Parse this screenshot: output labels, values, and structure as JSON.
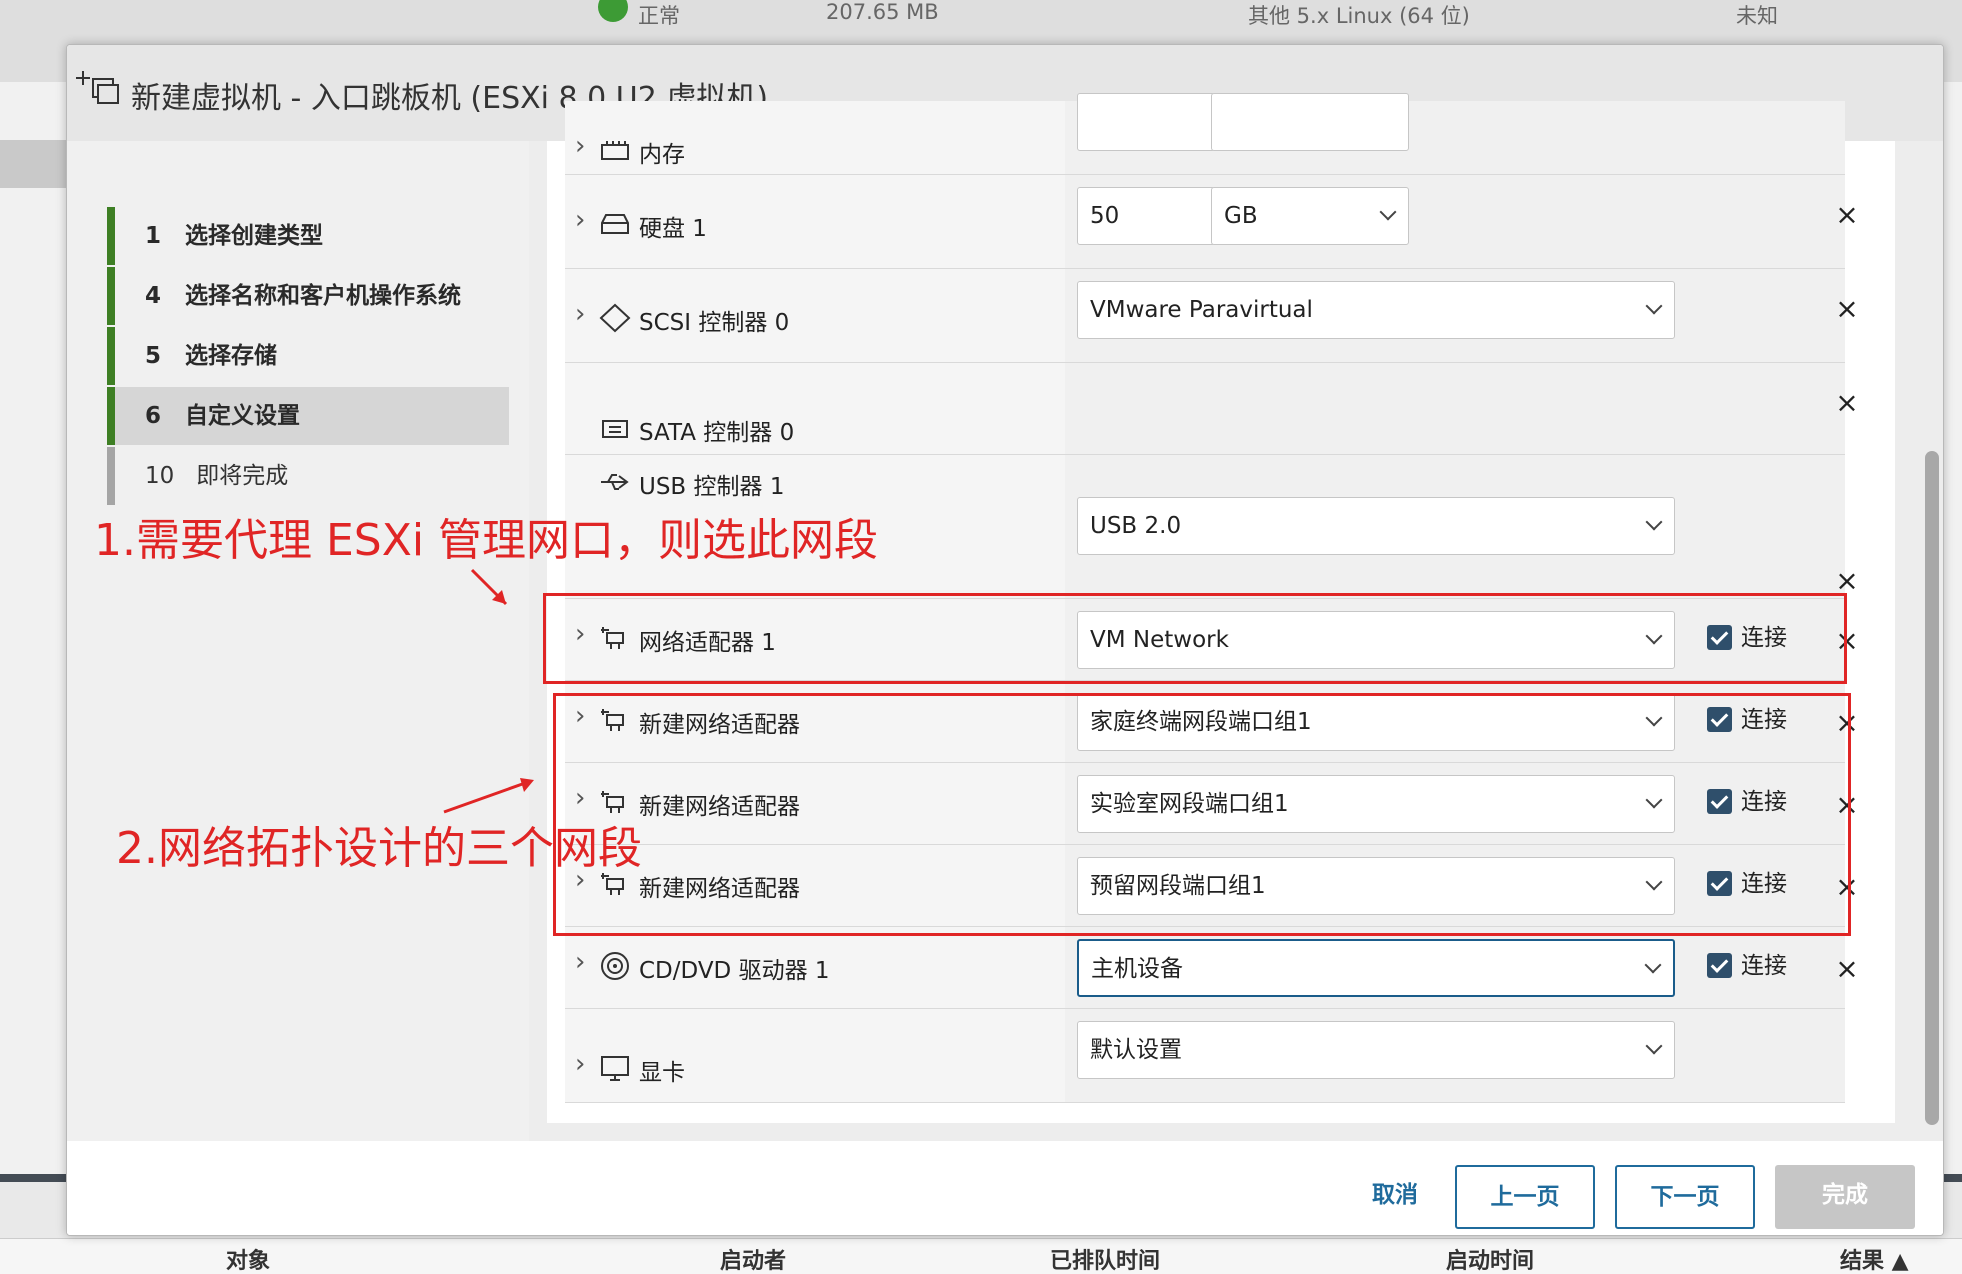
{
  "background": {
    "top_row": [
      "正常",
      "207.65 MB",
      "其他 5.x Linux (64 位)",
      "未知"
    ],
    "bottom_columns": [
      "对象",
      "启动者",
      "已排队时间",
      "启动时间",
      "结果 ▲"
    ]
  },
  "dialog": {
    "title": "新建虚拟机 - 入口跳板机 (ESXi 8.0 U2 虚拟机)"
  },
  "steps": [
    {
      "num": "1",
      "label": "选择创建类型"
    },
    {
      "num": "4",
      "label": "选择名称和客户机操作系统"
    },
    {
      "num": "5",
      "label": "选择存储"
    },
    {
      "num": "6",
      "label": "自定义设置"
    },
    {
      "num": "10",
      "label": "即将完成"
    }
  ],
  "hardware": {
    "memory": {
      "label": "内存"
    },
    "disk": {
      "label": "硬盘 1",
      "size": "50",
      "unit": "GB"
    },
    "scsi": {
      "label": "SCSI 控制器 0",
      "value": "VMware Paravirtual"
    },
    "sata": {
      "label": "SATA 控制器 0"
    },
    "usb": {
      "label": "USB 控制器 1",
      "value": "USB 2.0"
    },
    "nic1": {
      "label": "网络适配器 1",
      "value": "VM Network",
      "connect": "连接"
    },
    "nic2": {
      "label": "新建网络适配器",
      "value": "家庭终端网段端口组1",
      "connect": "连接"
    },
    "nic3": {
      "label": "新建网络适配器",
      "value": "实验室网段端口组1",
      "connect": "连接"
    },
    "nic4": {
      "label": "新建网络适配器",
      "value": "预留网段端口组1",
      "connect": "连接"
    },
    "cddvd": {
      "label": "CD/DVD 驱动器 1",
      "value": "主机设备",
      "connect": "连接"
    },
    "video": {
      "label": "显卡",
      "value": "默认设置"
    }
  },
  "footer": {
    "cancel": "取消",
    "back": "上一页",
    "next": "下一页",
    "finish": "完成"
  },
  "annotations": {
    "note1": "1.需要代理 ESXi 管理网口，则选此网段",
    "note2": "2.网络拓扑设计的三个网段"
  },
  "colors": {
    "accent": "#1f6b9c",
    "annotation": "#e02525",
    "completed_step": "#3e7f24"
  }
}
